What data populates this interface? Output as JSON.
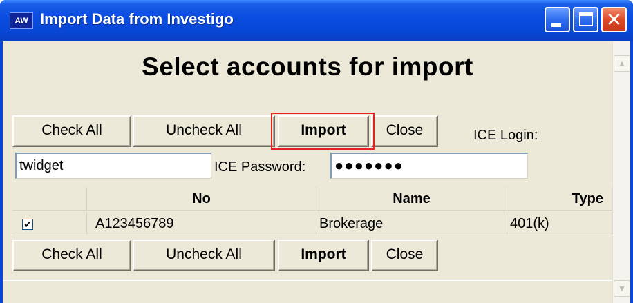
{
  "window": {
    "title": "Import Data from Investigo",
    "app_icon_text": "AW",
    "controls": {
      "minimize": "minimize",
      "maximize": "maximize",
      "close_glyph": "✕"
    },
    "colors": {
      "titlebar": "#0a4de0",
      "client": "#ece9d8",
      "highlight": "#e8211f"
    }
  },
  "heading": "Select accounts for import",
  "toolbar_top": {
    "check_all": "Check All",
    "uncheck_all": "Uncheck All",
    "import": "Import",
    "close": "Close"
  },
  "login": {
    "login_label": "ICE Login:",
    "login_value": "twidget",
    "password_label": "ICE Password:",
    "password_value": "●●●●●●●"
  },
  "table": {
    "columns": [
      "",
      "No",
      "Name",
      "Type"
    ],
    "rows": [
      {
        "checked": "✔",
        "no": "A123456789",
        "name": "Brokerage",
        "type": "401(k)"
      }
    ]
  },
  "toolbar_bottom": {
    "check_all": "Check All",
    "uncheck_all": "Uncheck All",
    "import": "Import",
    "close": "Close"
  },
  "scrollbar": {
    "up_icon": "▲",
    "down_icon": "▼"
  }
}
